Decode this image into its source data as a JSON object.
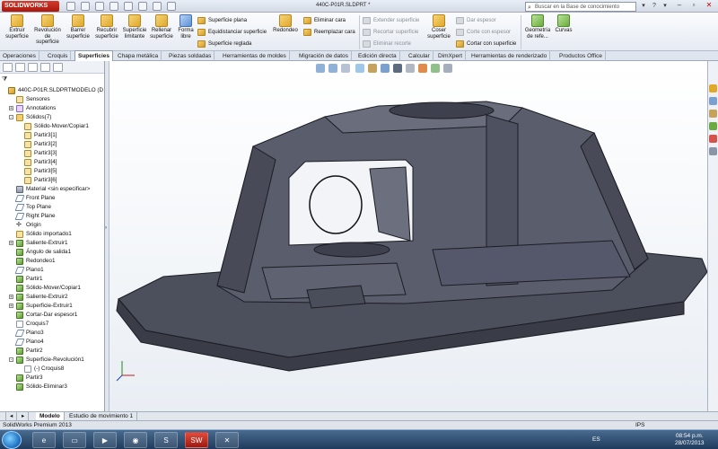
{
  "app": {
    "logo": "SOLIDWORKS",
    "doc_title": "440C-P01R.SLDPRT *",
    "search_placeholder": "Buscar en la Base de conocimiento"
  },
  "ribbon": {
    "big_buttons": [
      {
        "label": "Extruir superficie"
      },
      {
        "label": "Revolución de superficie"
      },
      {
        "label": "Barrer superficie"
      },
      {
        "label": "Recubrir superficie"
      },
      {
        "label": "Superficie limitante"
      },
      {
        "label": "Rellenar superficie"
      },
      {
        "label": "Forma libre"
      }
    ],
    "small_col1": [
      "Superficie plana",
      "Equidistanciar superficie",
      "Superficie reglada"
    ],
    "redondeo": "Redondeo",
    "small_col2": [
      "Eliminar cara",
      "Reemplazar cara"
    ],
    "small_col3": [
      "Extender superficie",
      "Recortar superficie",
      "Eliminar recorte"
    ],
    "coser": "Coser superficie",
    "small_col4": [
      "Dar espesor",
      "Corte con espesor",
      "Cortar con superficie"
    ],
    "geometria": "Geometría de refe...",
    "curvas": "Curvas"
  },
  "tabs": [
    "Operaciones",
    "Croquis",
    "Superficies",
    "Chapa metálica",
    "Piezas soldadas",
    "Herramientas de moldes",
    "Migración de datos",
    "Edición directa",
    "Calcular",
    "DimXpert",
    "Herramientas de renderizado",
    "Productos Office"
  ],
  "active_tab": "Superficies",
  "tree": [
    {
      "label": "440C-P01R.SLDPRTMODELO (D",
      "icon": "part",
      "indent": 0,
      "expander": ""
    },
    {
      "label": "Sensores",
      "icon": "sensor",
      "indent": 1,
      "expander": ""
    },
    {
      "label": "Annotations",
      "icon": "annot",
      "indent": 1,
      "expander": "+"
    },
    {
      "label": "Sólidos(7)",
      "icon": "folder",
      "indent": 1,
      "expander": "-"
    },
    {
      "label": "Sólido-Mover/Copiar1",
      "icon": "solid",
      "indent": 2,
      "expander": ""
    },
    {
      "label": "Partir3[1]",
      "icon": "solid",
      "indent": 2,
      "expander": ""
    },
    {
      "label": "Partir3[2]",
      "icon": "solid",
      "indent": 2,
      "expander": ""
    },
    {
      "label": "Partir3[3]",
      "icon": "solid",
      "indent": 2,
      "expander": ""
    },
    {
      "label": "Partir3[4]",
      "icon": "solid",
      "indent": 2,
      "expander": ""
    },
    {
      "label": "Partir3[5]",
      "icon": "solid",
      "indent": 2,
      "expander": ""
    },
    {
      "label": "Partir3[6]",
      "icon": "solid",
      "indent": 2,
      "expander": ""
    },
    {
      "label": "Material <sin especificar>",
      "icon": "mat",
      "indent": 1,
      "expander": ""
    },
    {
      "label": "Front Plane",
      "icon": "plane",
      "indent": 1,
      "expander": ""
    },
    {
      "label": "Top Plane",
      "icon": "plane",
      "indent": 1,
      "expander": ""
    },
    {
      "label": "Right Plane",
      "icon": "plane",
      "indent": 1,
      "expander": ""
    },
    {
      "label": "Origin",
      "icon": "origin",
      "indent": 1,
      "expander": ""
    },
    {
      "label": "Sólido importado1",
      "icon": "solid",
      "indent": 1,
      "expander": ""
    },
    {
      "label": "Saliente-Extruir1",
      "icon": "feat",
      "indent": 1,
      "expander": "+"
    },
    {
      "label": "Ángulo de salida1",
      "icon": "feat",
      "indent": 1,
      "expander": ""
    },
    {
      "label": "Redondeo1",
      "icon": "feat",
      "indent": 1,
      "expander": ""
    },
    {
      "label": "Plano1",
      "icon": "plane",
      "indent": 1,
      "expander": ""
    },
    {
      "label": "Partir1",
      "icon": "feat",
      "indent": 1,
      "expander": ""
    },
    {
      "label": "Sólido-Mover/Copiar1",
      "icon": "feat",
      "indent": 1,
      "expander": ""
    },
    {
      "label": "Saliente-Extruir2",
      "icon": "feat",
      "indent": 1,
      "expander": "+"
    },
    {
      "label": "Superficie-Extruir1",
      "icon": "feat",
      "indent": 1,
      "expander": "+"
    },
    {
      "label": "Cortar-Dar espesor1",
      "icon": "feat",
      "indent": 1,
      "expander": ""
    },
    {
      "label": "Croquis7",
      "icon": "sketch",
      "indent": 1,
      "expander": ""
    },
    {
      "label": "Plano3",
      "icon": "plane",
      "indent": 1,
      "expander": ""
    },
    {
      "label": "Plano4",
      "icon": "plane",
      "indent": 1,
      "expander": ""
    },
    {
      "label": "Partir2",
      "icon": "feat",
      "indent": 1,
      "expander": ""
    },
    {
      "label": "Superficie-Revolución1",
      "icon": "feat",
      "indent": 1,
      "expander": "-"
    },
    {
      "label": "(-) Croquis8",
      "icon": "sketch",
      "indent": 2,
      "expander": ""
    },
    {
      "label": "Partir3",
      "icon": "feat",
      "indent": 1,
      "expander": ""
    },
    {
      "label": "Sólido-Eliminar3",
      "icon": "feat",
      "indent": 1,
      "expander": ""
    }
  ],
  "model_tabs": [
    "Modelo",
    "Estudio de movimiento 1"
  ],
  "status": {
    "product": "SolidWorks Premium 2013",
    "units": "IPS"
  },
  "taskbar": {
    "lang": "ES",
    "time": "08:54 p.m.",
    "date": "28/07/2013"
  },
  "colors": {
    "solidworks_red": "#c8281a",
    "model_face": "#4a4d5a",
    "taskbar": "#2b4b6f"
  }
}
